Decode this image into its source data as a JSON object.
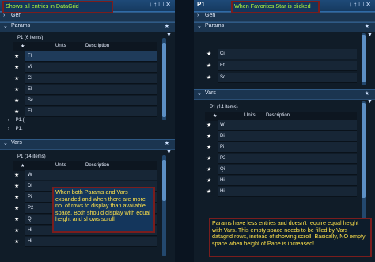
{
  "left": {
    "title": "P1",
    "title_icons": "↓↑☐✕",
    "annotation_top": "Shows all entries in DataGrid",
    "gen_label": "Gen",
    "params_label": "Params",
    "params_group": "P1 (6 items)",
    "columns": [
      "Units",
      "Description"
    ],
    "params_rows": [
      "Fl",
      "Vi",
      "Ci",
      "El",
      "Sc",
      "El"
    ],
    "tree_rows": [
      "P1.(",
      "P1."
    ],
    "vars_label": "Vars",
    "vars_group": "P1 (14 items)",
    "vars_rows": [
      "W",
      "Di",
      "Pi",
      "P2",
      "Qi",
      "Hi",
      "Hi"
    ],
    "annotation_vars": "When both Params and Vars expanded and when there are more no. of rows to display than available space. Both should display with equal height and shows scroll"
  },
  "right": {
    "title": "P1",
    "title_icons": "↓↑☐✕",
    "annotation_top": "When Favorites Star is clicked",
    "gen_label": "Gen",
    "params_label": "Params",
    "params_rows": [
      "Ci",
      "Ef",
      "Sc"
    ],
    "vars_label": "Vars",
    "vars_group": "P1 (14 items)",
    "columns": [
      "Units",
      "Description"
    ],
    "vars_rows": [
      "W",
      "Di",
      "Pi",
      "P2",
      "Qi",
      "Hi",
      "Hi"
    ],
    "annotation_bottom": "Params have less entries and doesn't require equal height with Vars. This empty space needs to be filled by Vars datagrid rows, instead of showing scroll. Basically, NO empty space when height of Pane is increased!"
  },
  "colors": {
    "accent": "#2f6aa6",
    "note_border": "#7a1d1d",
    "note_text": "#ffe24a"
  }
}
